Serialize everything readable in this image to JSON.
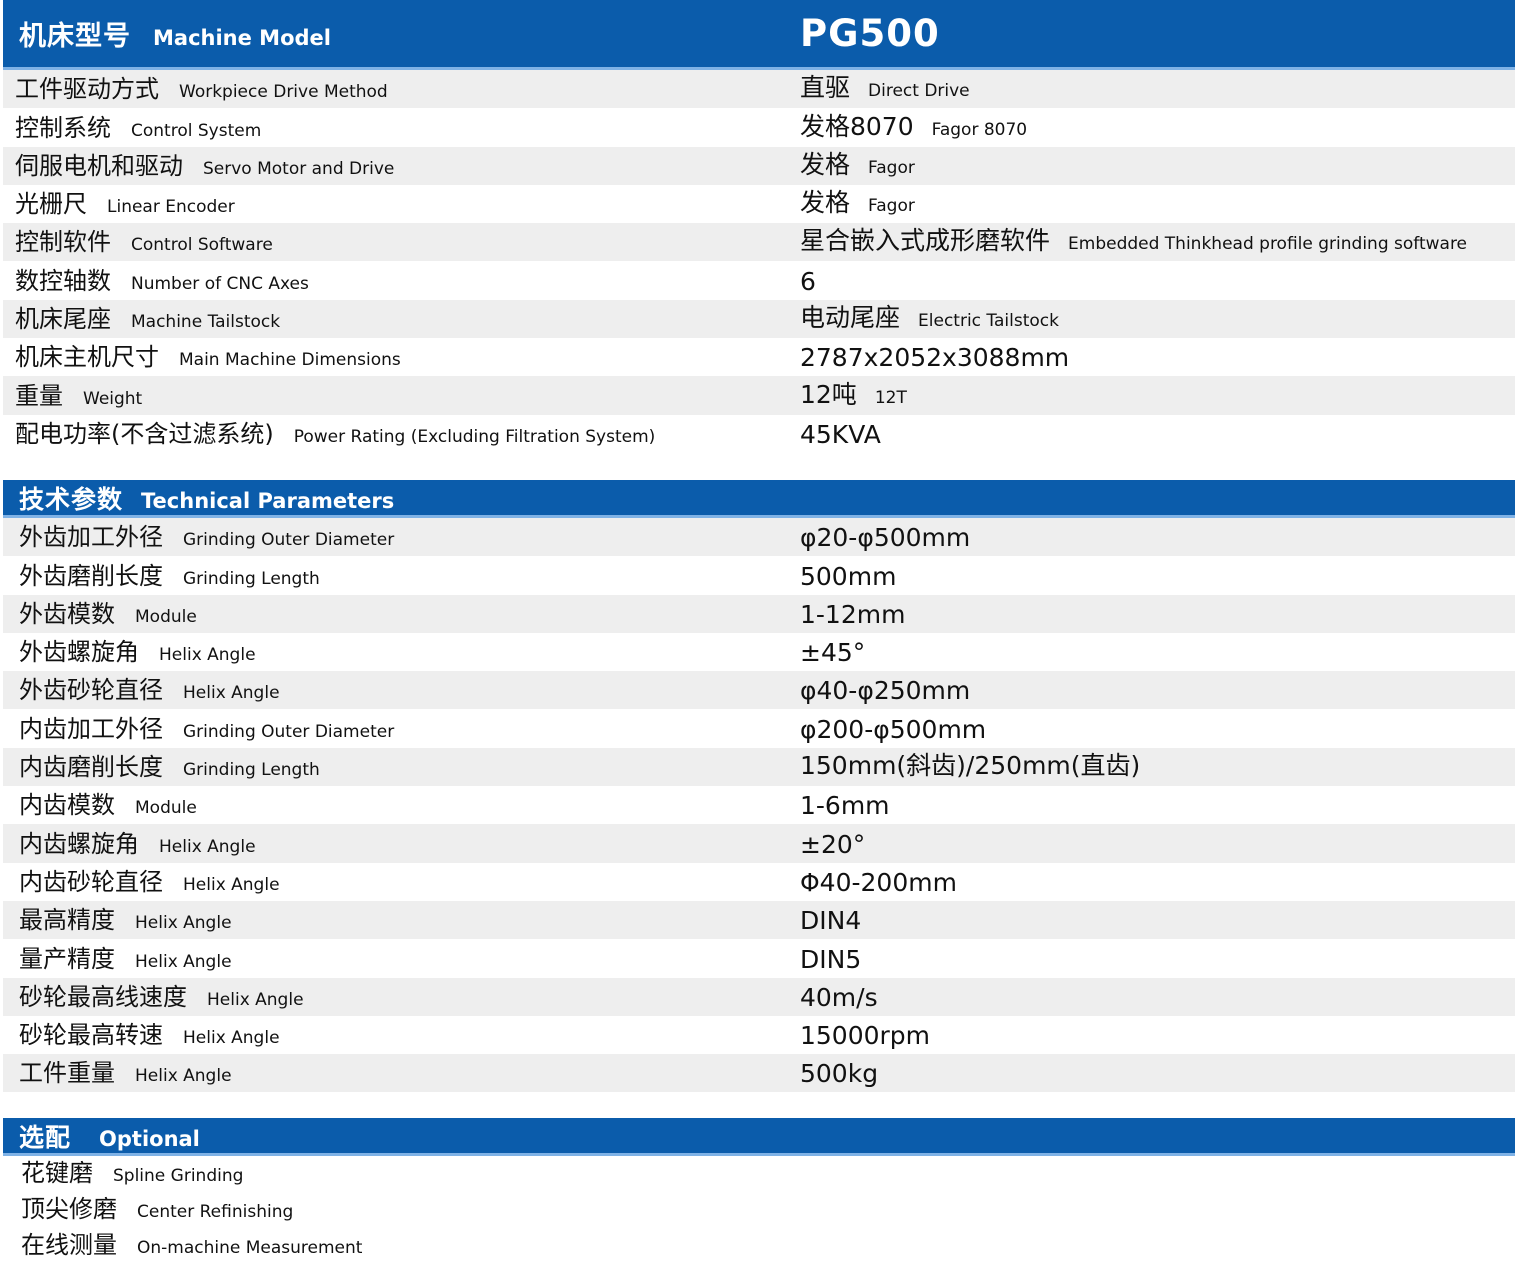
{
  "machine": {
    "title_cn": "机床型号",
    "title_en": "Machine Model",
    "model": "PG500",
    "rows": [
      {
        "label_cn": "工件驱动方式",
        "label_en": "Workpiece Drive Method",
        "value_cn": "直驱",
        "value_en": "Direct Drive"
      },
      {
        "label_cn": "控制系统",
        "label_en": "Control System",
        "value_cn": "发格8070",
        "value_en": "Fagor 8070"
      },
      {
        "label_cn": "伺服电机和驱动",
        "label_en": "Servo Motor and Drive",
        "value_cn": "发格",
        "value_en": "Fagor"
      },
      {
        "label_cn": "光栅尺",
        "label_en": "Linear Encoder",
        "value_cn": "发格",
        "value_en": "Fagor"
      },
      {
        "label_cn": "控制软件",
        "label_en": "Control Software",
        "value_cn": "星合嵌入式成形磨软件",
        "value_en": "Embedded Thinkhead profile grinding software"
      },
      {
        "label_cn": "数控轴数",
        "label_en": "Number of CNC Axes",
        "value_cn": "6",
        "value_en": ""
      },
      {
        "label_cn": "机床尾座",
        "label_en": "Machine Tailstock",
        "value_cn": "电动尾座",
        "value_en": "Electric Tailstock"
      },
      {
        "label_cn": "机床主机尺寸",
        "label_en": "Main Machine Dimensions",
        "value_cn": "2787x2052x3088mm",
        "value_en": ""
      },
      {
        "label_cn": "重量",
        "label_en": "Weight",
        "value_cn": "12吨",
        "value_en": "12T"
      },
      {
        "label_cn": "配电功率(不含过滤系统)",
        "label_en": "Power Rating (Excluding Filtration System)",
        "value_cn": "45KVA",
        "value_en": ""
      }
    ]
  },
  "technical": {
    "title_cn": "技术参数",
    "title_en": "Technical Parameters",
    "rows": [
      {
        "label_cn": "外齿加工外径",
        "label_en": "Grinding Outer Diameter",
        "value": "φ20-φ500mm"
      },
      {
        "label_cn": "外齿磨削长度",
        "label_en": "Grinding Length",
        "value": "500mm"
      },
      {
        "label_cn": "外齿模数",
        "label_en": "Module",
        "value": "1-12mm"
      },
      {
        "label_cn": "外齿螺旋角",
        "label_en": "Helix Angle",
        "value": "±45°"
      },
      {
        "label_cn": "外齿砂轮直径",
        "label_en": "Helix Angle",
        "value": "φ40-φ250mm"
      },
      {
        "label_cn": "内齿加工外径",
        "label_en": "Grinding Outer Diameter",
        "value": "φ200-φ500mm"
      },
      {
        "label_cn": "内齿磨削长度",
        "label_en": "Grinding Length",
        "value": "150mm(斜齿)/250mm(直齿)"
      },
      {
        "label_cn": "内齿模数",
        "label_en": "Module",
        "value": "1-6mm"
      },
      {
        "label_cn": "内齿螺旋角",
        "label_en": "Helix Angle",
        "value": "±20°"
      },
      {
        "label_cn": "内齿砂轮直径",
        "label_en": "Helix Angle",
        "value": "Φ40-200mm"
      },
      {
        "label_cn": "最高精度",
        "label_en": "Helix Angle",
        "value": "DIN4"
      },
      {
        "label_cn": "量产精度",
        "label_en": "Helix Angle",
        "value": "DIN5"
      },
      {
        "label_cn": "砂轮最高线速度",
        "label_en": "Helix Angle",
        "value": "40m/s"
      },
      {
        "label_cn": "砂轮最高转速",
        "label_en": "Helix Angle",
        "value": "15000rpm"
      },
      {
        "label_cn": "工件重量",
        "label_en": "Helix Angle",
        "value": "500kg"
      }
    ]
  },
  "optional": {
    "title_cn": "选配",
    "title_en": "Optional",
    "rows": [
      {
        "label_cn": "花键磨",
        "label_en": "Spline Grinding"
      },
      {
        "label_cn": "顶尖修磨",
        "label_en": "Center Refinishing"
      },
      {
        "label_cn": "在线测量",
        "label_en": "On-machine Measurement"
      }
    ]
  },
  "colors": {
    "header_blue": "#0b5cab",
    "row_alt": "#eeeeee"
  }
}
